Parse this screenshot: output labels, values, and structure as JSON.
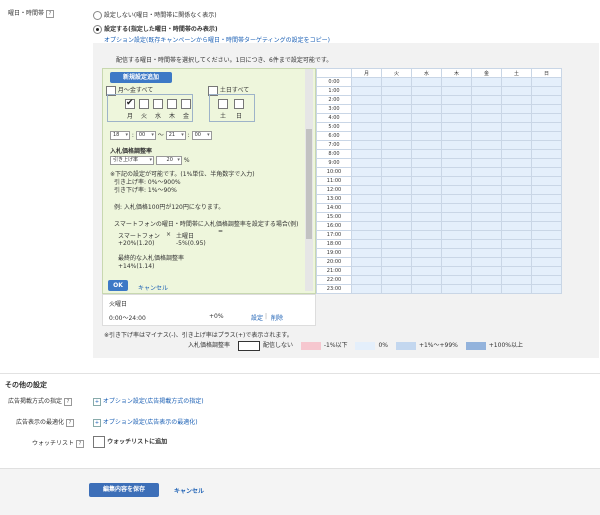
{
  "schedule": {
    "label": "曜日・時間帯",
    "option_none": "設定しない(曜日・時間帯に関係なく表示)",
    "option_set": "設定する(指定した曜日・時間帯のみ表示)",
    "copy_link": "オプション設定(既存キャンペーンから曜日・時間帯ターゲティングの設定をコピー)",
    "instruction": "配信する曜日・時間帯を選択してください。1日につき、6件まで設定可能です。",
    "add_button": "新規設定追加",
    "weekday_all": "月～金すべて",
    "weekend_all": "土日すべて",
    "weekdays": [
      "月",
      "火",
      "水",
      "木",
      "金"
    ],
    "weekend": [
      "土",
      "日"
    ],
    "time_start_hour": "18",
    "time_start_min": "00",
    "time_sep": "～",
    "time_end_hour": "21",
    "time_end_min": "00",
    "bid_title": "入札価格調整率",
    "bid_direction": "引き上げ率",
    "bid_value": "20",
    "bid_unit": "%",
    "bid_note1": "※下記の設定が可能です。(1%単位、半角数字で入力)",
    "bid_note2": "引き上げ率: 0%～900%",
    "bid_note3": "引き下げ率: 1%～90%",
    "bid_example": "例: 入札価格100円が120円になります。",
    "sp_note": "スマートフォンの曜日・時間帯に入札価格調整率を設定する場合(例)",
    "sp_label": "スマートフォン",
    "sp_times": "×",
    "sp_sat": "土曜日",
    "sp_eq": "=",
    "sp_value1": "+20%(1.20)",
    "sp_value2": "-5%(0.95)",
    "sp_final_label": "最終的な入札価格調整率",
    "sp_final_value": "+14%(1.14)",
    "ok_button": "OK",
    "cancel_link": "キャンセル",
    "entry_day": "火曜日",
    "entry_time": "0:00～24:00",
    "entry_rate": "+0%",
    "entry_set": "設定",
    "entry_sep": "|",
    "entry_delete": "削除",
    "grid_days": [
      "月",
      "火",
      "水",
      "木",
      "金",
      "土",
      "日"
    ],
    "grid_hours": [
      "0:00",
      "1:00",
      "2:00",
      "3:00",
      "4:00",
      "5:00",
      "6:00",
      "7:00",
      "8:00",
      "9:00",
      "10:00",
      "11:00",
      "12:00",
      "13:00",
      "14:00",
      "15:00",
      "16:00",
      "17:00",
      "18:00",
      "19:00",
      "20:00",
      "21:00",
      "22:00",
      "23:00"
    ],
    "grid_note": "※引き下げ率はマイナス(-)、引き上げ率はプラス(+)で表示されます。",
    "legend_title": "入札価格調整率",
    "legend": [
      {
        "label": "配信しない",
        "color": "#ffffff"
      },
      {
        "label": "-1%以下",
        "color": "#f6c7cf"
      },
      {
        "label": "0%",
        "color": "#e4effb"
      },
      {
        "label": "+1%～+99%",
        "color": "#c3d7ef"
      },
      {
        "label": "+100%以上",
        "color": "#93b3dc"
      }
    ]
  },
  "other": {
    "title": "その他の設定",
    "ad_method_label": "広告掲載方式の指定",
    "ad_method_link": "オプション設定(広告掲載方式の指定)",
    "optimize_label": "広告表示の最適化",
    "optimize_link": "オプション設定(広告表示の最適化)",
    "watchlist_label": "ウォッチリスト",
    "watchlist_option": "ウォッチリストに追加"
  },
  "footer": {
    "save_button": "編集内容を保存",
    "cancel_link": "キャンセル"
  },
  "colors": {
    "grid_fill": "#e4effb",
    "panel_green": "#eef6dc",
    "button_blue": "#3d79c6"
  }
}
